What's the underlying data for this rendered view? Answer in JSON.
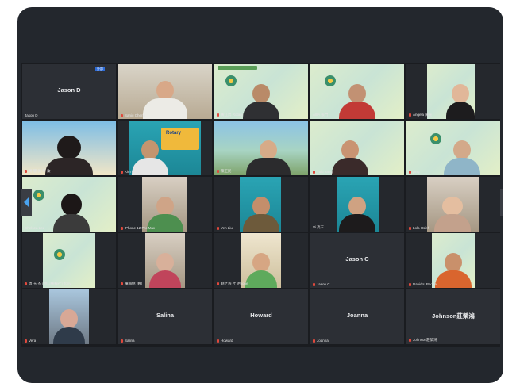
{
  "meeting": {
    "next_icon": "chevron-right-icon",
    "prev_icon": "chevron-left-icon"
  },
  "tiles": {
    "r1c1": {
      "name": "Jason D",
      "label": "Jason D",
      "badge": "外部"
    },
    "r1c2": {
      "label": "Sanju Cheng"
    },
    "r1c3": {
      "label": "黃江昇 Rotary"
    },
    "r1c4": {
      "label": "AllIA 張門"
    },
    "r1c5": {
      "label": "Angela 陳光"
    },
    "r2c1": {
      "label": "周 慧 黃 萃 汝"
    },
    "r2c2": {
      "label": "Kim Chen"
    },
    "r2c3": {
      "label": "陳正民"
    },
    "r2c4": {
      "label": "Yuki Yang"
    },
    "r2c5": {
      "label": "ping"
    },
    "r3c1": {
      "label": "Chelsea Lee"
    },
    "r3c2": {
      "label": "iPhone 12 Pro Max"
    },
    "r3c3": {
      "label": "Yen Liu"
    },
    "r3c4": {
      "label": "Vi 高三"
    },
    "r3c5": {
      "label": "Lola Hsieh"
    },
    "r4c1": {
      "label": "周 玉 杰 (林口扶輪社) Tony"
    },
    "r4c2": {
      "label": "陳梅姑 (楓)"
    },
    "r4c3": {
      "label": "劉之燕 社 iPhone"
    },
    "r4c4": {
      "name": "Jason C",
      "label": "Jason C"
    },
    "r4c5": {
      "label": "David's iPhone"
    },
    "r5c1": {
      "label": "Vera"
    },
    "r5c2": {
      "name": "Salina",
      "label": "Salina"
    },
    "r5c3": {
      "name": "Howard",
      "label": "Howard"
    },
    "r5c4": {
      "name": "Joanna",
      "label": "Joanna"
    },
    "r5c5": {
      "name": "Johnson莊榮鴻",
      "label": "Johnson莊榮鴻"
    }
  },
  "rotary_card": {
    "text": "Rotary"
  },
  "colors": {
    "frame_bg": "#23272d",
    "grid_bg": "#1a1c20",
    "tile_bg": "#25282d",
    "active_speaker": "#7fc250",
    "muted_mic": "#e0493d"
  }
}
